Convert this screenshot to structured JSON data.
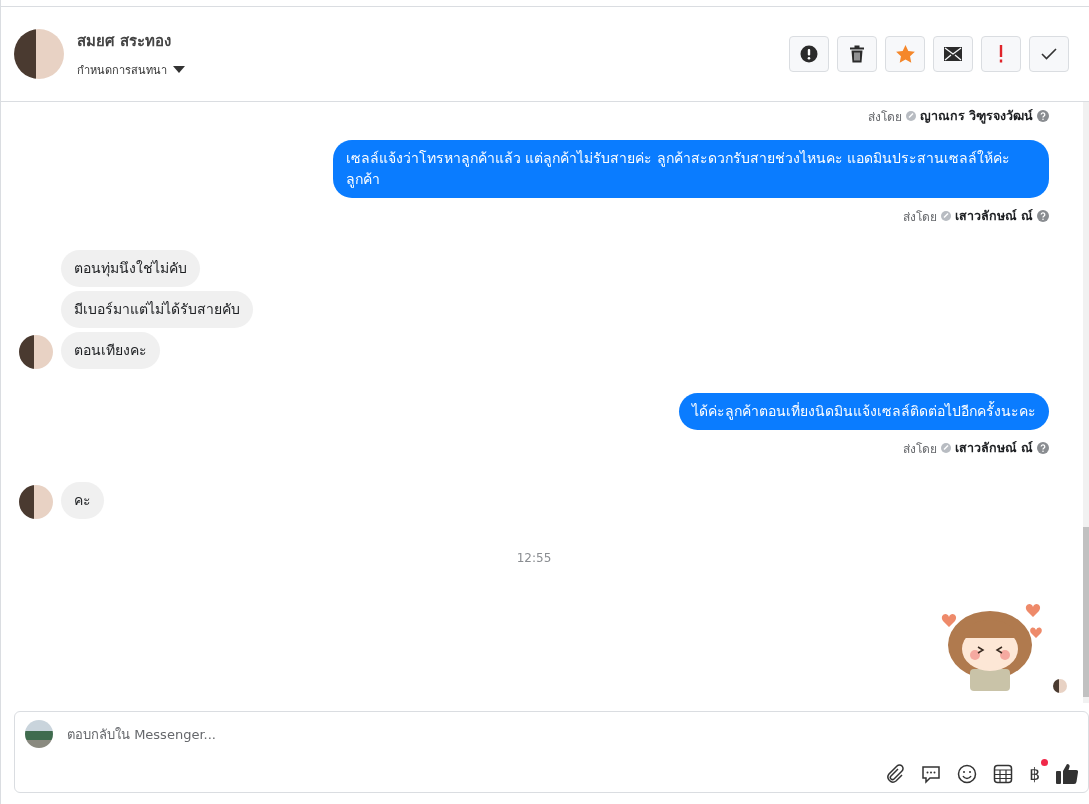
{
  "header": {
    "contact_name": "สมยศ สระทอง",
    "conversation_menu": "กำหนดการสนทนา",
    "actions": [
      {
        "kind": "spam"
      },
      {
        "kind": "delete"
      },
      {
        "kind": "star"
      },
      {
        "kind": "unread"
      },
      {
        "kind": "important"
      },
      {
        "kind": "done"
      }
    ]
  },
  "messages": [
    {
      "kind": "outgoing_cut",
      "sent_by_label": "ส่งโดย",
      "sender": "ญาณกร วิฑูรจงวัฒน์"
    },
    {
      "kind": "outgoing",
      "text": "เซลล์แจ้งว่าโทรหาลูกค้าแล้ว แต่ลูกค้าไม่รับสายค่ะ ลูกค้าสะดวกรับสายช่วงไหนคะ แอดมินประสานเซลล์ให้ค่ะลูกค้า",
      "sent_by_label": "ส่งโดย",
      "sender": "เสาวลักษณ์ ณ์"
    },
    {
      "kind": "incoming",
      "bubbles": [
        "ตอนทุ่มนึงใช่ไม่คับ",
        "มีเบอร์มาแต่ไม่ได้รับสายคับ",
        "ตอนเทียงคะ"
      ]
    },
    {
      "kind": "outgoing",
      "text": "ได้ค่ะลูกค้าตอนเที่ยงนิดมินแจ้งเซลล์ติดต่อไปอีกครั้งนะคะ",
      "sent_by_label": "ส่งโดย",
      "sender": "เสาวลักษณ์ ณ์"
    },
    {
      "kind": "incoming",
      "bubbles": [
        "คะ"
      ]
    },
    {
      "kind": "time",
      "text": "12:55"
    },
    {
      "kind": "sticker"
    }
  ],
  "composer": {
    "placeholder": "ตอบกลับใน Messenger...",
    "payment_symbol": "฿"
  }
}
